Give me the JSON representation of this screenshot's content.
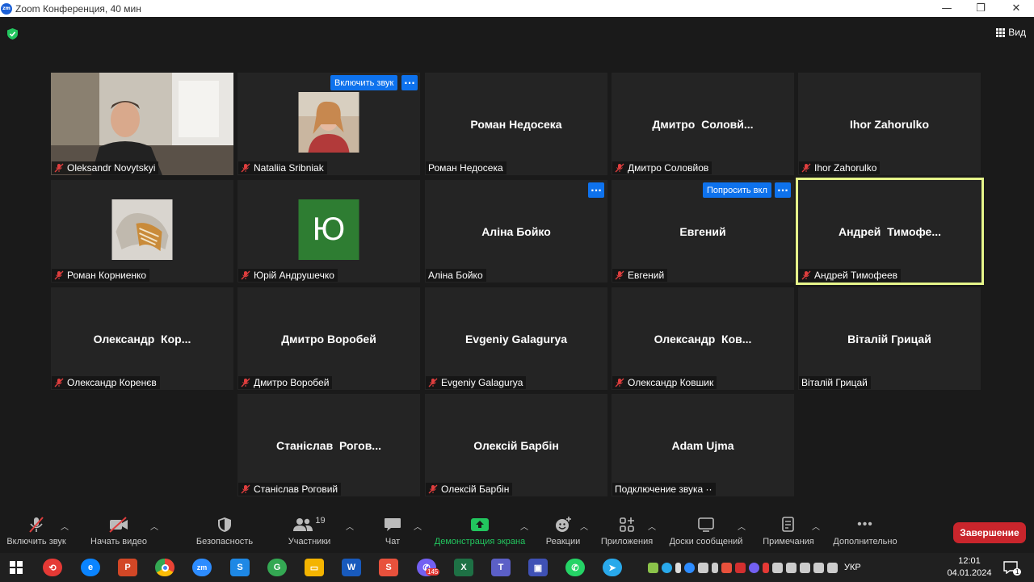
{
  "window": {
    "title": "Zoom Конференция, 40 мин",
    "logo_text": "zm"
  },
  "header": {
    "view_label": "Вид"
  },
  "tiles": [
    {
      "label": "Oleksandr Novytskyi",
      "center": "",
      "muted": true,
      "kind": "video"
    },
    {
      "label": "Nataliia Sribniak",
      "center": "",
      "muted": true,
      "kind": "photo",
      "button": "Включить звук"
    },
    {
      "label": "Роман Недосека",
      "center": "Роман Недосека",
      "muted": false
    },
    {
      "label": "Дмитро Соловйов",
      "center": "Дмитро  Соловй...",
      "muted": true
    },
    {
      "label": "Ihor Zahorulko",
      "center": "Ihor Zahorulko",
      "muted": true
    },
    {
      "label": "Роман Корниенко",
      "center": "",
      "muted": true,
      "kind": "photo2"
    },
    {
      "label": "Юрій Андрушечко",
      "center": "",
      "muted": true,
      "kind": "avatar",
      "avatar_letter": "Ю"
    },
    {
      "label": "Аліна Бойко",
      "center": "Аліна Бойко",
      "muted": false
    },
    {
      "label": "Евгений",
      "center": "Евгений",
      "muted": true,
      "button": "Попросить вкл"
    },
    {
      "label": "Андрей Тимофеев",
      "center": "Андрей  Тимофе...",
      "muted": true,
      "active": true
    },
    {
      "label": "Олександр Коренєв",
      "center": "Олександр  Кор...",
      "muted": true
    },
    {
      "label": "Дмитро Воробей",
      "center": "Дмитро Воробей",
      "muted": true
    },
    {
      "label": "Evgeniy Galagurya",
      "center": "Evgeniy Galagurya",
      "muted": true
    },
    {
      "label": "Олександр Ковшик",
      "center": "Олександр  Ков...",
      "muted": true
    },
    {
      "label": "Віталій Грицай",
      "center": "Віталій Грицай",
      "muted": false
    },
    {
      "label": "Станіслав Роговий",
      "center": "Станіслав  Рогов...",
      "muted": true
    },
    {
      "label": "Олексій Барбін",
      "center": "Олексій Барбін",
      "muted": true
    },
    {
      "label": "Подключение звука ··",
      "center": "Adam Ujma",
      "muted": false
    }
  ],
  "toolbar": {
    "unmute": "Включить звук",
    "start_video": "Начать видео",
    "security": "Безопасность",
    "participants": "Участники",
    "participants_count": "19",
    "chat": "Чат",
    "share_screen": "Демонстрация экрана",
    "reactions": "Реакции",
    "apps": "Приложения",
    "whiteboards": "Доски сообщений",
    "notes": "Примечания",
    "more": "Дополнительно",
    "end": "Завершение"
  },
  "taskbar": {
    "language": "УКР",
    "time": "12:01",
    "date": "04.01.2024",
    "viber_badge": "145",
    "notification_badge": "1"
  },
  "colors": {
    "active_speaker": "#e6f58a",
    "accent_blue": "#0e72ed",
    "end_red": "#c9252c",
    "share_green": "#22c55e"
  }
}
